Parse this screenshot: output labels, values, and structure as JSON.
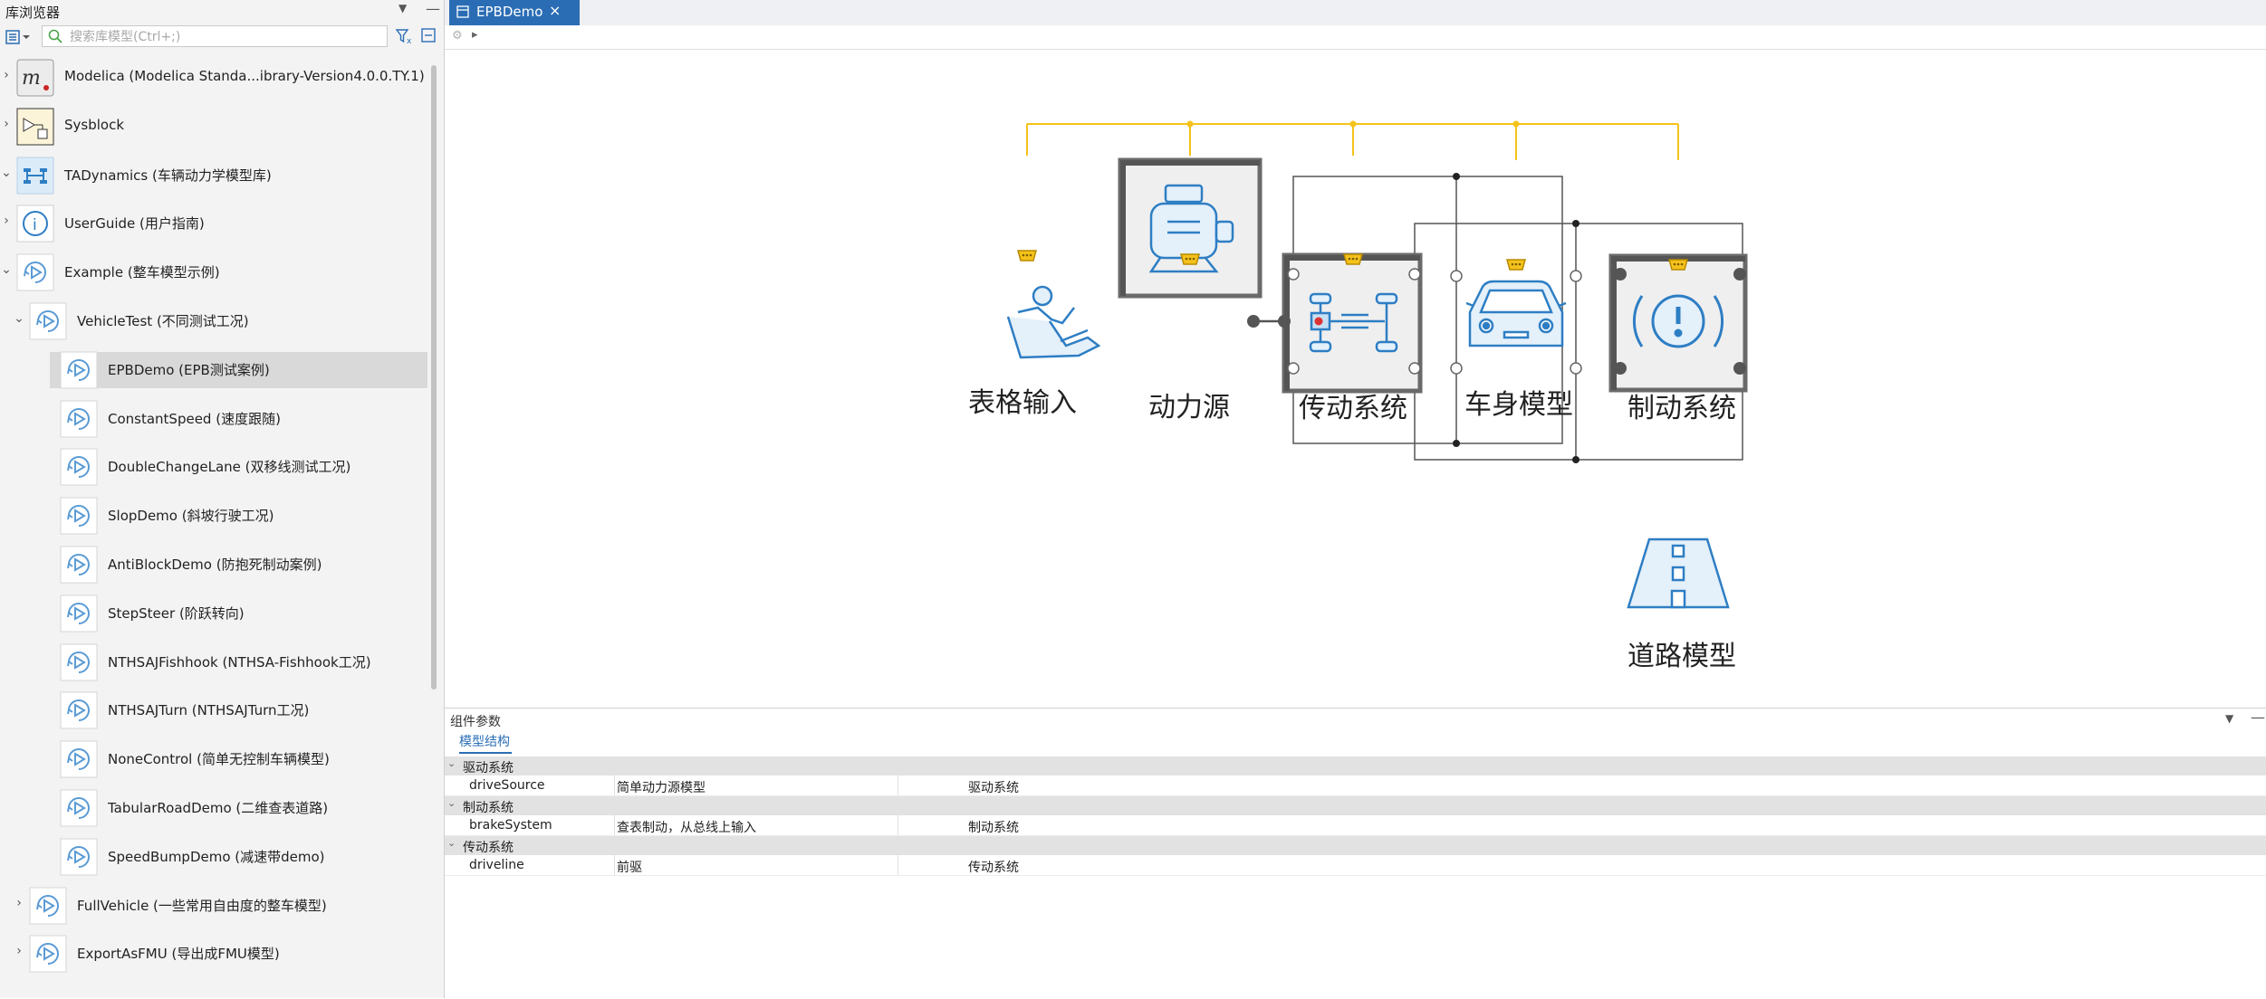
{
  "library_browser": {
    "title": "库浏览器",
    "search": {
      "placeholder": "搜索库模型(Ctrl+;)",
      "value": ""
    },
    "tree": [
      {
        "label": "Modelica (Modelica Standa...ibrary-Version4.0.0.TY.1)",
        "icon": "modelica-logo-icon",
        "expanded": false
      },
      {
        "label": "Sysblock",
        "icon": "sysblock-icon",
        "expanded": false
      },
      {
        "label": "TADynamics (车辆动力学模型库)",
        "icon": "tadynamics-icon",
        "expanded": true
      },
      {
        "label": "UserGuide (用户指南)",
        "icon": "info-icon",
        "expanded": false
      },
      {
        "label": "Example (整车模型示例)",
        "icon": "example-play-icon",
        "expanded": true
      },
      {
        "label": "VehicleTest (不同测试工况)",
        "icon": "example-play-icon",
        "expanded": true
      },
      {
        "label": "EPBDemo (EPB测试案例)",
        "icon": "example-play-icon",
        "selected": true
      },
      {
        "label": "ConstantSpeed (速度跟随)",
        "icon": "example-play-icon"
      },
      {
        "label": "DoubleChangeLane (双移线测试工况)",
        "icon": "example-play-icon"
      },
      {
        "label": "SlopDemo (斜坡行驶工况)",
        "icon": "example-play-icon"
      },
      {
        "label": "AntiBlockDemo (防抱死制动案例)",
        "icon": "example-play-icon"
      },
      {
        "label": "StepSteer (阶跃转向)",
        "icon": "example-play-icon"
      },
      {
        "label": "NTHSAJFishhook (NTHSA-Fishhook工况)",
        "icon": "example-play-icon"
      },
      {
        "label": "NTHSAJTurn (NTHSAJTurn工况)",
        "icon": "example-play-icon"
      },
      {
        "label": "NoneControl (简单无控制车辆模型)",
        "icon": "example-play-icon"
      },
      {
        "label": "TabularRoadDemo (二维查表道路)",
        "icon": "example-play-icon"
      },
      {
        "label": "SpeedBumpDemo (减速带demo)",
        "icon": "example-play-icon"
      },
      {
        "label": "FullVehicle (一些常用自由度的整车模型)",
        "icon": "example-play-icon",
        "expanded": false
      },
      {
        "label": "ExportAsFMU (导出成FMU模型)",
        "icon": "example-play-icon",
        "expanded": false
      }
    ]
  },
  "editor": {
    "tab_label": "EPBDemo",
    "components": {
      "table_input": "表格输入",
      "power_source": "动力源",
      "driveline": "传动系统",
      "body": "车身模型",
      "brake": "制动系统",
      "road": "道路模型"
    },
    "colors": {
      "bus_line": "#f5c21b",
      "icon_blue": "#2e7ec4",
      "icon_fill": "#e4f0fa"
    }
  },
  "params_panel": {
    "title": "组件参数",
    "tab": "模型结构",
    "groups": [
      {
        "label": "驱动系统",
        "rows": [
          {
            "name": "driveSource",
            "value": "简单动力源模型",
            "desc": "驱动系统"
          }
        ]
      },
      {
        "label": "制动系统",
        "rows": [
          {
            "name": "brakeSystem",
            "value": "查表制动，从总线上输入",
            "desc": "制动系统"
          }
        ]
      },
      {
        "label": "传动系统",
        "rows": [
          {
            "name": "driveline",
            "value": "前驱",
            "desc": "传动系统"
          }
        ]
      }
    ]
  }
}
